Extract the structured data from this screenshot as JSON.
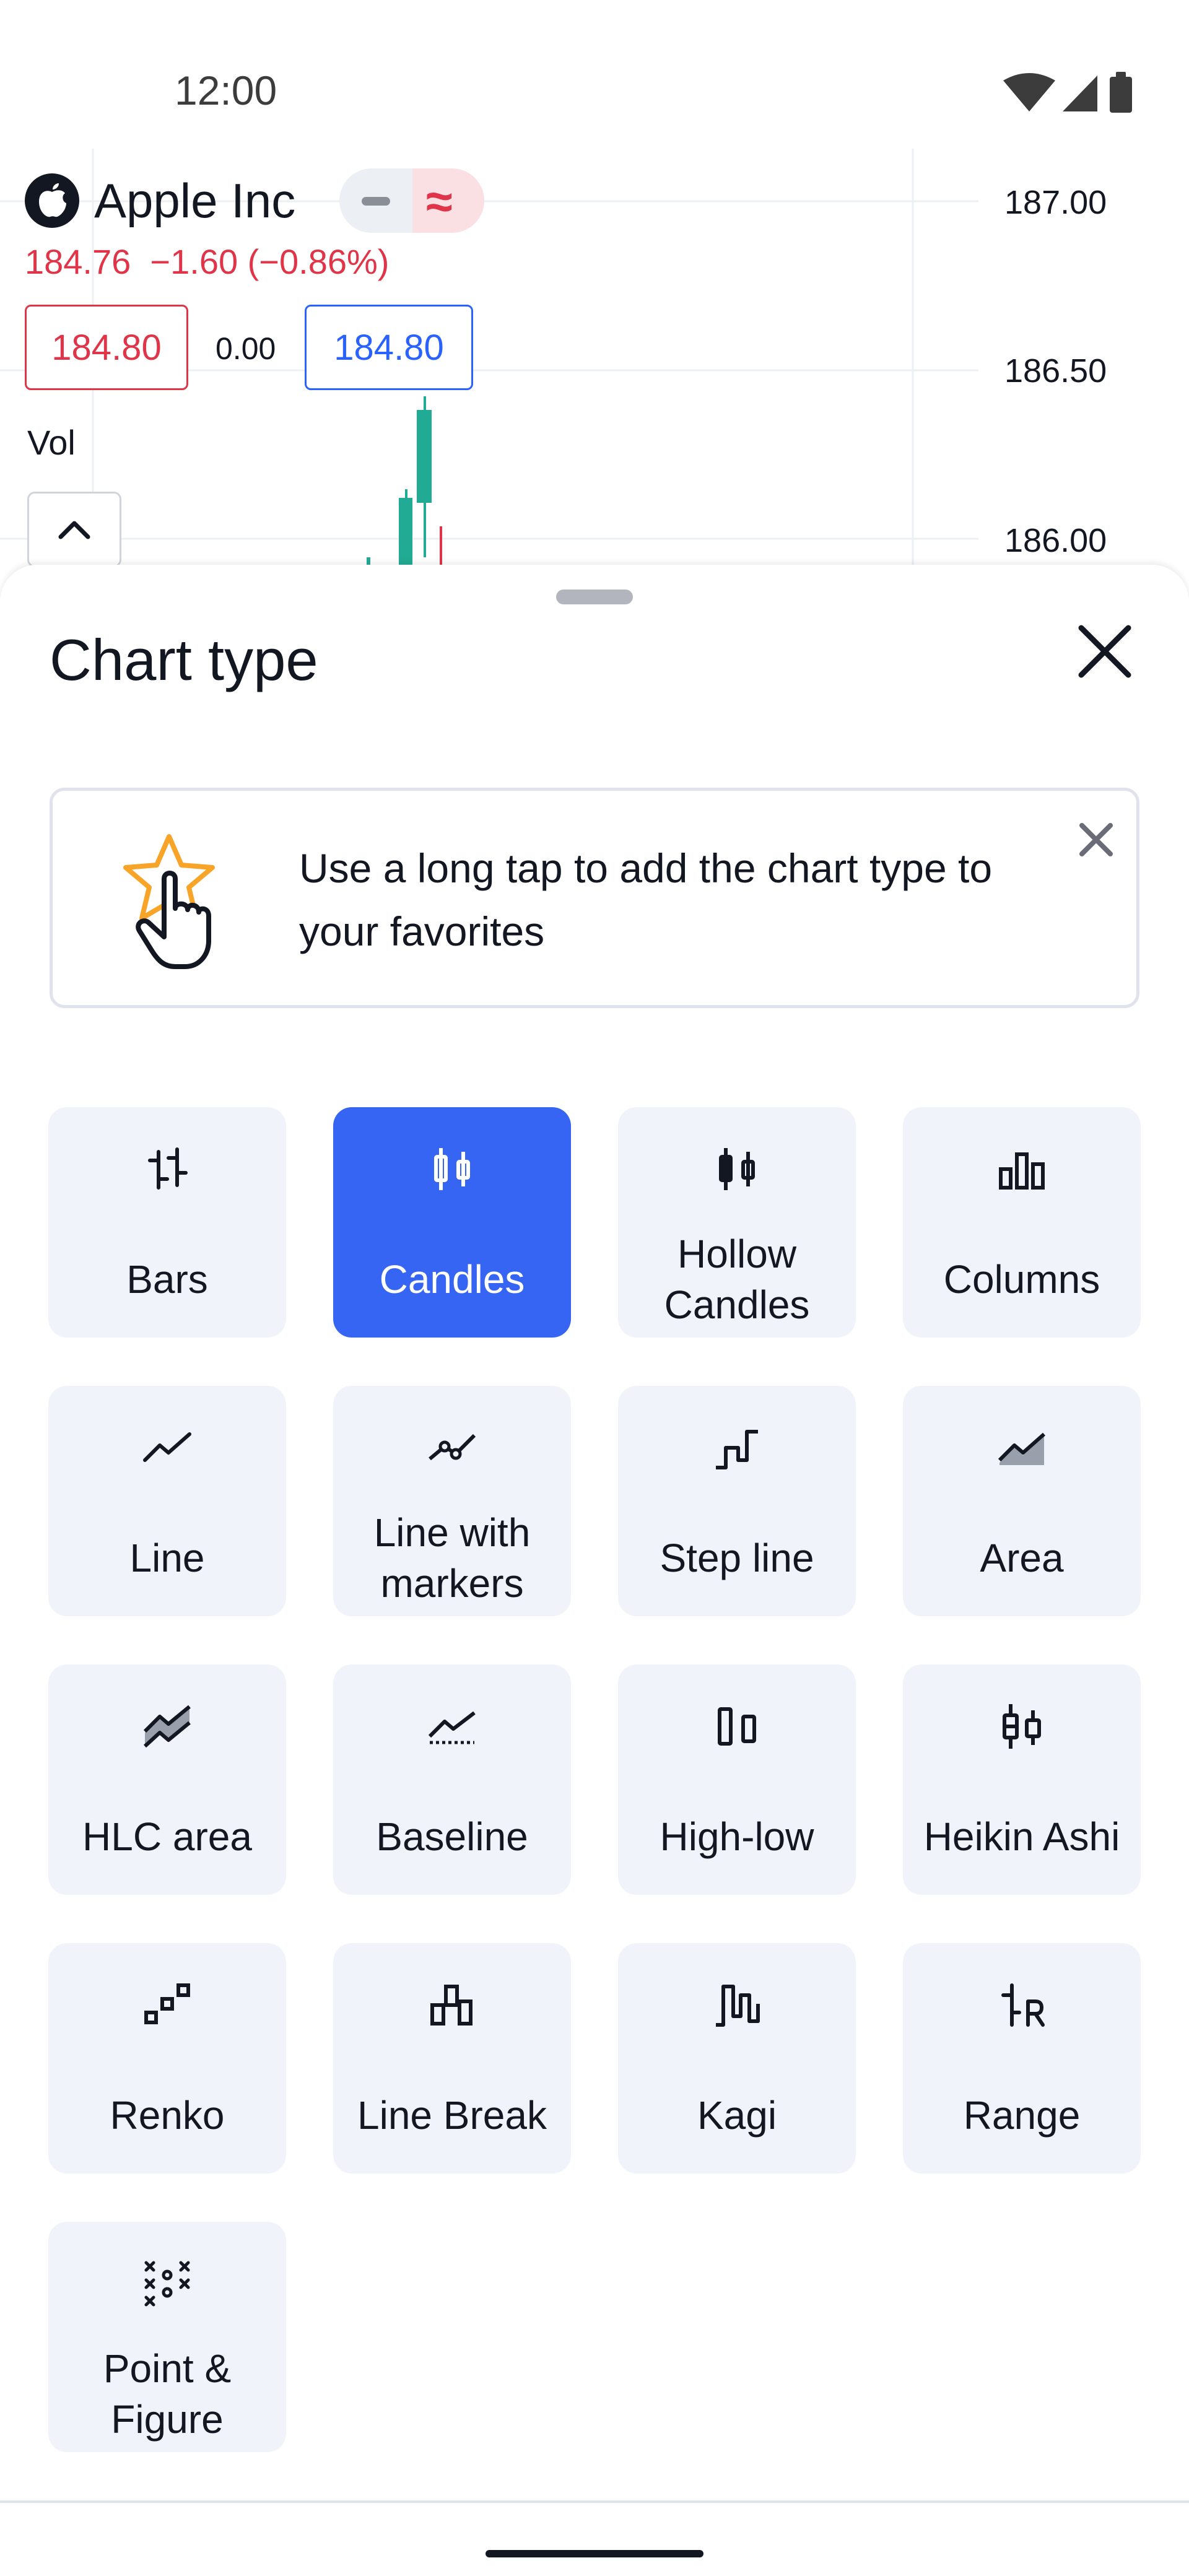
{
  "status_bar": {
    "time": "12:00"
  },
  "chart": {
    "symbol": "Apple Inc",
    "last_price": "184.76",
    "change": "−1.60 (−0.86%)",
    "sell_price": "184.80",
    "spread": "0.00",
    "buy_price": "184.80",
    "volume_label": "Vol",
    "price_axis": [
      "187.00",
      "186.50",
      "186.00"
    ],
    "colors": {
      "up": "#22ab94",
      "down": "#e03448",
      "accent": "#2962ff"
    }
  },
  "sheet": {
    "title": "Chart type",
    "hint_text": "Use a long tap to add the chart type to your favorites",
    "selected": "Candles",
    "types": [
      {
        "label": "Bars",
        "icon": "bars-icon"
      },
      {
        "label": "Candles",
        "icon": "candles-icon"
      },
      {
        "label": "Hollow Candles",
        "icon": "hollow-candles-icon"
      },
      {
        "label": "Columns",
        "icon": "columns-icon"
      },
      {
        "label": "Line",
        "icon": "line-icon"
      },
      {
        "label": "Line with markers",
        "icon": "line-markers-icon"
      },
      {
        "label": "Step line",
        "icon": "step-line-icon"
      },
      {
        "label": "Area",
        "icon": "area-icon"
      },
      {
        "label": "HLC area",
        "icon": "hlc-area-icon"
      },
      {
        "label": "Baseline",
        "icon": "baseline-icon"
      },
      {
        "label": "High-low",
        "icon": "high-low-icon"
      },
      {
        "label": "Heikin Ashi",
        "icon": "heikin-ashi-icon"
      },
      {
        "label": "Renko",
        "icon": "renko-icon"
      },
      {
        "label": "Line Break",
        "icon": "line-break-icon"
      },
      {
        "label": "Kagi",
        "icon": "kagi-icon"
      },
      {
        "label": "Range",
        "icon": "range-icon"
      },
      {
        "label": "Point & Figure",
        "icon": "point-figure-icon"
      }
    ]
  }
}
